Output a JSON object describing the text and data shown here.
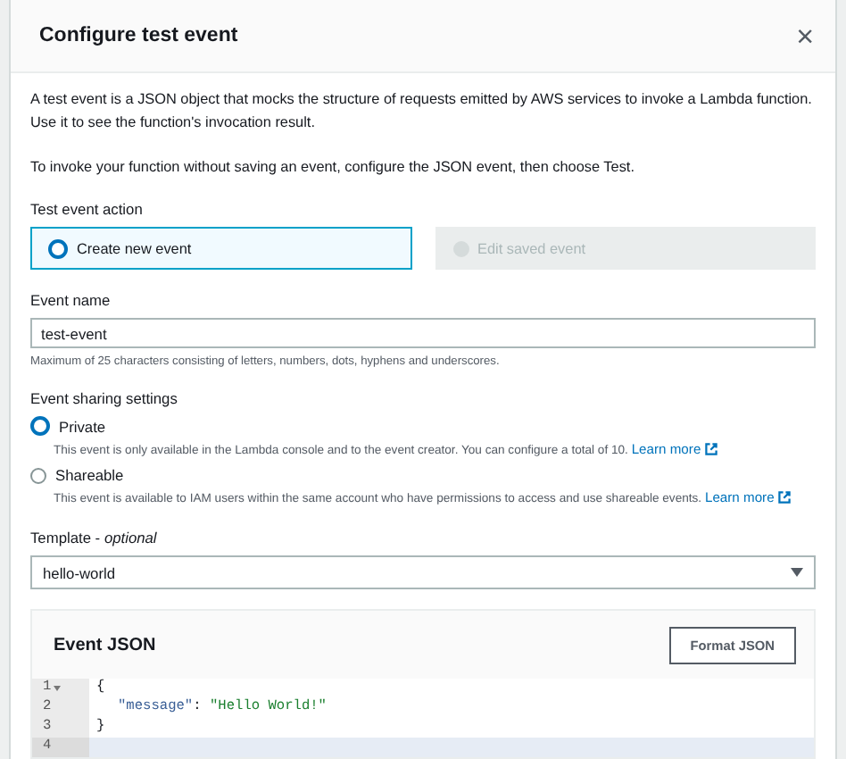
{
  "dialog": {
    "title": "Configure test event",
    "close_icon": "×"
  },
  "intro": [
    "A test event is a JSON object that mocks the structure of requests emitted by AWS services to invoke a Lambda function. Use it to see the function's invocation result.",
    "To invoke your function without saving an event, configure the JSON event, then choose Test."
  ],
  "test_event_action": {
    "label": "Test event action",
    "options": [
      {
        "label": "Create new event",
        "selected": true,
        "disabled": false
      },
      {
        "label": "Edit saved event",
        "selected": false,
        "disabled": true
      }
    ]
  },
  "event_name": {
    "label": "Event name",
    "value": "test-event",
    "hint": "Maximum of 25 characters consisting of letters, numbers, dots, hyphens and underscores."
  },
  "sharing": {
    "label": "Event sharing settings",
    "options": [
      {
        "label": "Private",
        "selected": true,
        "description": "This event is only available in the Lambda console and to the event creator. You can configure a total of 10.",
        "link": "Learn more"
      },
      {
        "label": "Shareable",
        "selected": false,
        "description": "This event is available to IAM users within the same account who have permissions to access and use shareable events.",
        "link": "Learn more"
      }
    ]
  },
  "template": {
    "label": "Template - ",
    "optional": "optional",
    "value": "hello-world"
  },
  "event_json": {
    "title": "Event JSON",
    "button": "Format JSON",
    "lines": [
      {
        "number": "1",
        "foldable": true,
        "active": false,
        "tokens": [
          {
            "kind": "punct",
            "text": "{"
          }
        ]
      },
      {
        "number": "2",
        "foldable": false,
        "active": false,
        "indent": true,
        "tokens": [
          {
            "kind": "key",
            "text": "\"message\""
          },
          {
            "kind": "punct",
            "text": ": "
          },
          {
            "kind": "string",
            "text": "\"Hello World!\""
          }
        ]
      },
      {
        "number": "3",
        "foldable": false,
        "active": false,
        "tokens": [
          {
            "kind": "punct",
            "text": "}"
          }
        ]
      },
      {
        "number": "4",
        "foldable": false,
        "active": true
      }
    ]
  }
}
